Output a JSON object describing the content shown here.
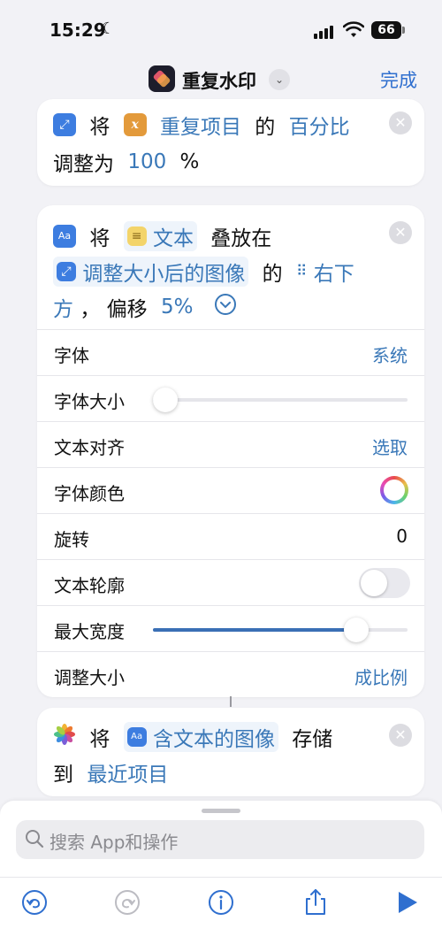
{
  "status": {
    "time": "15:29",
    "battery": "66"
  },
  "nav": {
    "title": "重复水印",
    "done_label": "完成"
  },
  "card1": {
    "word_jiang": "将",
    "variable": "重复项目",
    "word_de": "的",
    "percent_token": "百分比",
    "word_adjust": "调整为",
    "value": "100",
    "unit": "%"
  },
  "card2": {
    "word_jiang": "将",
    "text_token": "文本",
    "word_overlay": "叠放在",
    "image_token": "调整大小后的图像",
    "word_de": "的",
    "position_token_1": "右下",
    "position_token_2": "方",
    "comma": "，",
    "word_offset": "偏移",
    "offset_value": "5%",
    "rows": {
      "font": {
        "label": "字体",
        "value": "系统"
      },
      "font_size": {
        "label": "字体大小",
        "level": 0.05
      },
      "alignment": {
        "label": "文本对齐",
        "value": "选取"
      },
      "color": {
        "label": "字体颜色"
      },
      "rotation": {
        "label": "旋转",
        "value": "0"
      },
      "outline": {
        "label": "文本轮廓",
        "on": false
      },
      "max_width": {
        "label": "最大宽度",
        "level": 0.8
      },
      "resize": {
        "label": "调整大小",
        "value": "成比例"
      }
    }
  },
  "card3": {
    "word_jiang": "将",
    "image_token": "含文本的图像",
    "word_save": "存储",
    "word_to": "到",
    "album_token": "最近项目"
  },
  "bottom": {
    "search_placeholder": "搜索 App和操作",
    "toolbar_icons": [
      "undo-icon",
      "redo-icon",
      "info-icon",
      "share-icon",
      "play-icon"
    ]
  },
  "colors": {
    "accent": "#3a78b8",
    "link": "#2f6fcf"
  }
}
